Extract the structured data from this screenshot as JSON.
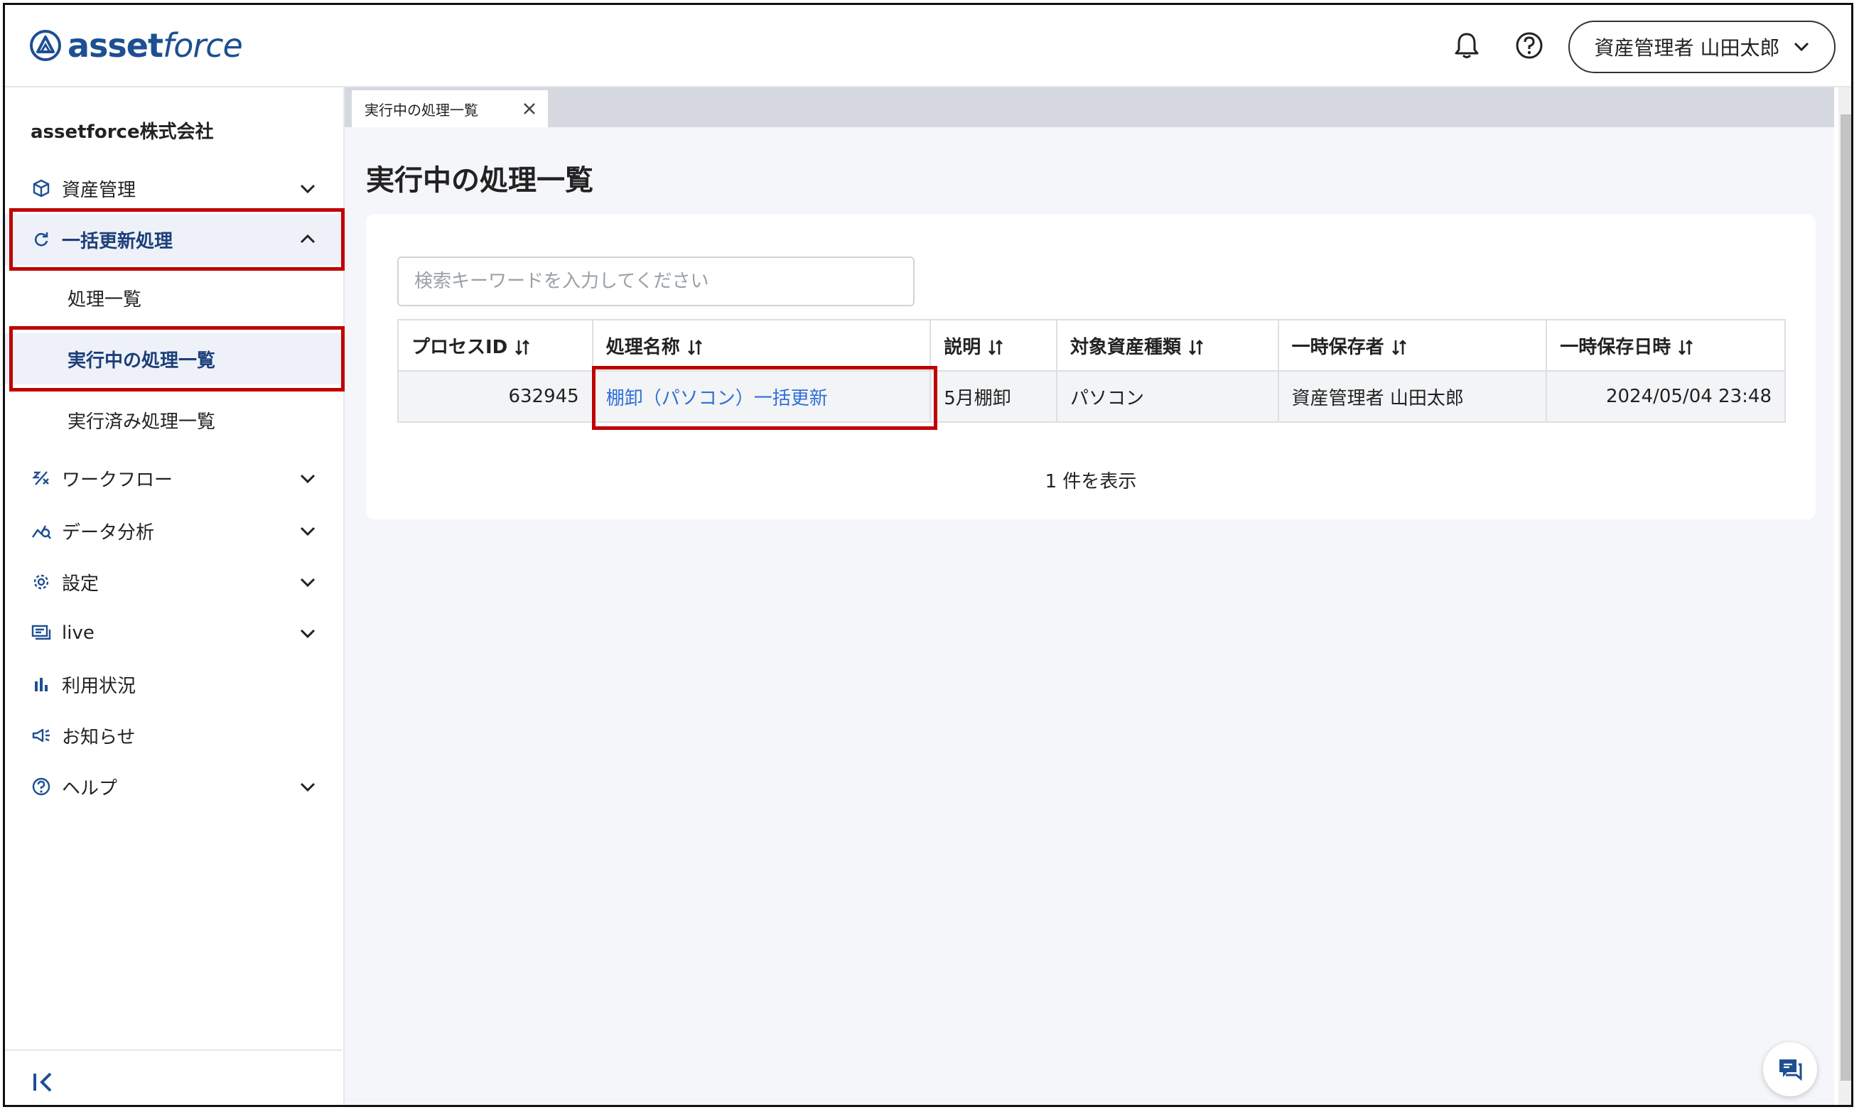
{
  "header": {
    "logo_asset": "asset",
    "logo_force": "force",
    "user_label": "資産管理者 山田太郎"
  },
  "sidebar": {
    "company": "assetforce株式会社",
    "items": [
      {
        "label": "資産管理",
        "icon": "cube-icon"
      },
      {
        "label": "一括更新処理",
        "icon": "refresh-icon"
      },
      {
        "label": "ワークフロー",
        "icon": "workflow-icon"
      },
      {
        "label": "データ分析",
        "icon": "analytics-icon"
      },
      {
        "label": "設定",
        "icon": "gear-icon"
      },
      {
        "label": "live",
        "icon": "live-icon"
      },
      {
        "label": "利用状況",
        "icon": "bar-chart-icon"
      },
      {
        "label": "お知らせ",
        "icon": "megaphone-icon"
      },
      {
        "label": "ヘルプ",
        "icon": "help-icon"
      }
    ],
    "sub_items": [
      {
        "label": "処理一覧"
      },
      {
        "label": "実行中の処理一覧"
      },
      {
        "label": "実行済み処理一覧"
      }
    ]
  },
  "tabs": [
    {
      "label": "実行中の処理一覧"
    }
  ],
  "main": {
    "title": "実行中の処理一覧",
    "search_placeholder": "検索キーワードを入力してください",
    "columns": [
      "プロセスID",
      "処理名称",
      "説明",
      "対象資産種類",
      "一時保存者",
      "一時保存日時"
    ],
    "rows": [
      {
        "id": "632945",
        "name": "棚卸（パソコン）一括更新",
        "desc": "5月棚卸",
        "asset_type": "パソコン",
        "saver": "資産管理者 山田太郎",
        "saved_at": "2024/05/04 23:48"
      }
    ],
    "count_text": "1 件を表示"
  },
  "colors": {
    "accent": "#1d4f91",
    "link": "#2f6fd8",
    "highlight": "#c00000"
  }
}
